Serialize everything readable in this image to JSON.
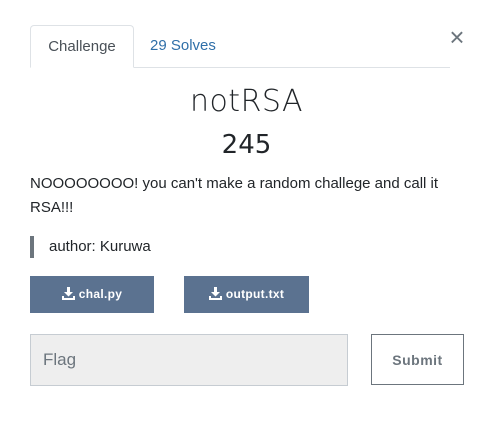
{
  "modal": {
    "close_symbol": "×",
    "tabs": [
      {
        "label": "Challenge",
        "active": true
      },
      {
        "label": "29 Solves",
        "active": false
      }
    ]
  },
  "challenge": {
    "name": "notRSA",
    "value": "245",
    "description": "NOOOOOOOO! you can't make a random challege and call it RSA!!!",
    "author": "author: Kuruwa"
  },
  "files": [
    {
      "label": "chal.py",
      "icon": "download-icon"
    },
    {
      "label": "output.txt",
      "icon": "download-icon"
    }
  ],
  "submission": {
    "placeholder": "Flag",
    "value": "",
    "submit_label": "Submit"
  },
  "colors": {
    "file_button_bg": "#5b7290",
    "tab_link": "#2f6fa8",
    "input_bg": "#eeeeee",
    "quote_border": "#6c757d"
  }
}
